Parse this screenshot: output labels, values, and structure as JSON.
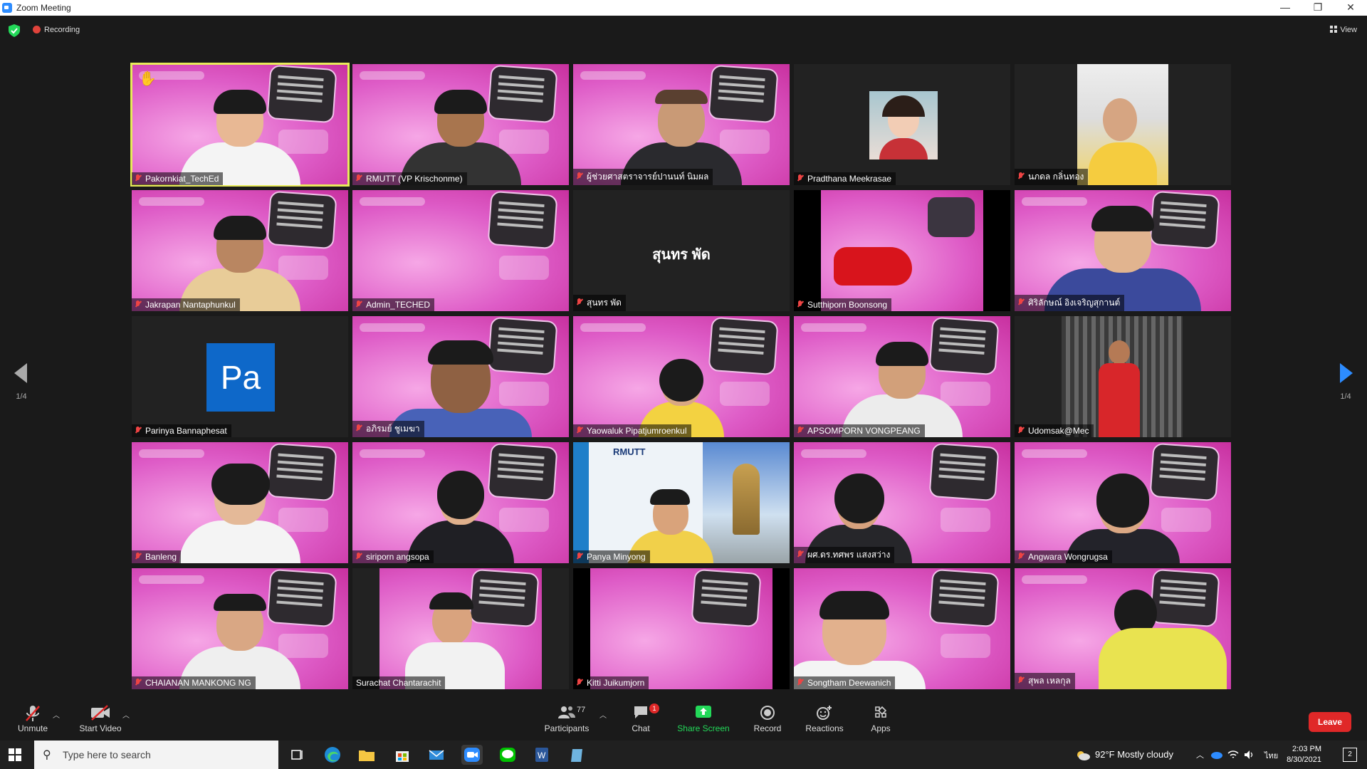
{
  "window": {
    "title": "Zoom Meeting",
    "minimize": "—",
    "restore": "❐",
    "close": "✕"
  },
  "topbar": {
    "recording_label": "Recording",
    "view_label": "View"
  },
  "pager": {
    "left": "1/4",
    "right": "1/4"
  },
  "tiles": [
    {
      "name": "Pakornkiat_TechEd",
      "active": true,
      "hand": true
    },
    {
      "name": "RMUTT (VP Krischonme)"
    },
    {
      "name": "ผู้ช่วยศาสตราจารย์ปานนท์ นิมผล"
    },
    {
      "name": "Pradthana Meekrasae"
    },
    {
      "name": "นภดล กลิ่นทอง"
    },
    {
      "name": "Jakrapan Nantaphunkul"
    },
    {
      "name": "Admin_TECHED"
    },
    {
      "name": "สุนทร พัด",
      "display_text": "สุนทร พัด"
    },
    {
      "name": "Sutthiporn Boonsong"
    },
    {
      "name": "ศิริลักษณ์ อิงเจริญสุกานต์"
    },
    {
      "name": "Parinya Bannaphesat",
      "avatar_text": "Pa"
    },
    {
      "name": "อภิรมย์ ชูเมฆา"
    },
    {
      "name": "Yaowaluk Pipatjumroenkul"
    },
    {
      "name": "APSOMPORN VONGPEANG"
    },
    {
      "name": "Udomsak@Mec"
    },
    {
      "name": "Banleng"
    },
    {
      "name": "siriporn angsopa"
    },
    {
      "name": "Panya Minyong"
    },
    {
      "name": "ผศ.ดร.ทศพร แสงสว่าง"
    },
    {
      "name": "Angwara Wongrugsa"
    },
    {
      "name": "CHAIANAN MANKONG NG"
    },
    {
      "name": "Surachat Chantarachit"
    },
    {
      "name": "Kitti Juikumjorn"
    },
    {
      "name": "Songtham Deewanich"
    },
    {
      "name": "สุพล เหลกุล"
    }
  ],
  "toolbar": {
    "unmute": "Unmute",
    "start_video": "Start Video",
    "participants": "Participants",
    "participants_count": "77",
    "chat": "Chat",
    "chat_badge": "1",
    "share_screen": "Share Screen",
    "record": "Record",
    "reactions": "Reactions",
    "apps": "Apps",
    "leave": "Leave"
  },
  "taskbar": {
    "search_placeholder": "Type here to search",
    "weather": "92°F  Mostly cloudy",
    "language": "ไทย",
    "time": "2:03 PM",
    "date": "8/30/2021",
    "notifications": "2"
  },
  "colors": {
    "accent_green": "#23d959",
    "leave_red": "#e02828",
    "active_border": "#e8eb5a",
    "share_green": "#23d959"
  }
}
